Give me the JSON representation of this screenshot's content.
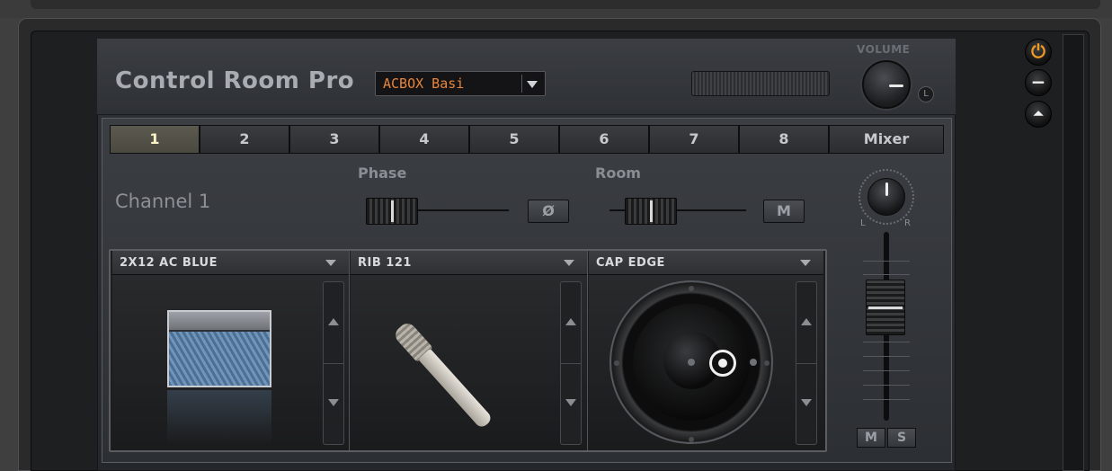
{
  "header": {
    "title": "Control Room Pro",
    "preset_value": "ACBOX Basi",
    "volume_label": "VOLUME",
    "volume_l_label": "L"
  },
  "side_controls": {
    "power_glyph": "⏻",
    "minimize_glyph": "−",
    "collapse_glyph": "⏶"
  },
  "tabs": [
    {
      "label": "1",
      "active": true
    },
    {
      "label": "2",
      "active": false
    },
    {
      "label": "3",
      "active": false
    },
    {
      "label": "4",
      "active": false
    },
    {
      "label": "5",
      "active": false
    },
    {
      "label": "6",
      "active": false
    },
    {
      "label": "7",
      "active": false
    },
    {
      "label": "8",
      "active": false
    },
    {
      "label": "Mixer",
      "active": false
    }
  ],
  "channel": {
    "name": "Channel 1",
    "phase_label": "Phase",
    "phase_button": "Ø",
    "room_label": "Room",
    "room_button": "M"
  },
  "mixer": {
    "pan_l": "L",
    "pan_r": "R",
    "mute_label": "M",
    "solo_label": "S"
  },
  "slots": [
    {
      "label": "2X12 AC BLUE",
      "icon": "cabinet-icon"
    },
    {
      "label": "RIB 121",
      "icon": "ribbon-mic-icon"
    },
    {
      "label": "CAP EDGE",
      "icon": "speaker-icon"
    }
  ],
  "colors": {
    "preset_text": "#e8853a",
    "power_icon": "#f09a26",
    "active_tab": "#fbf3c8"
  }
}
